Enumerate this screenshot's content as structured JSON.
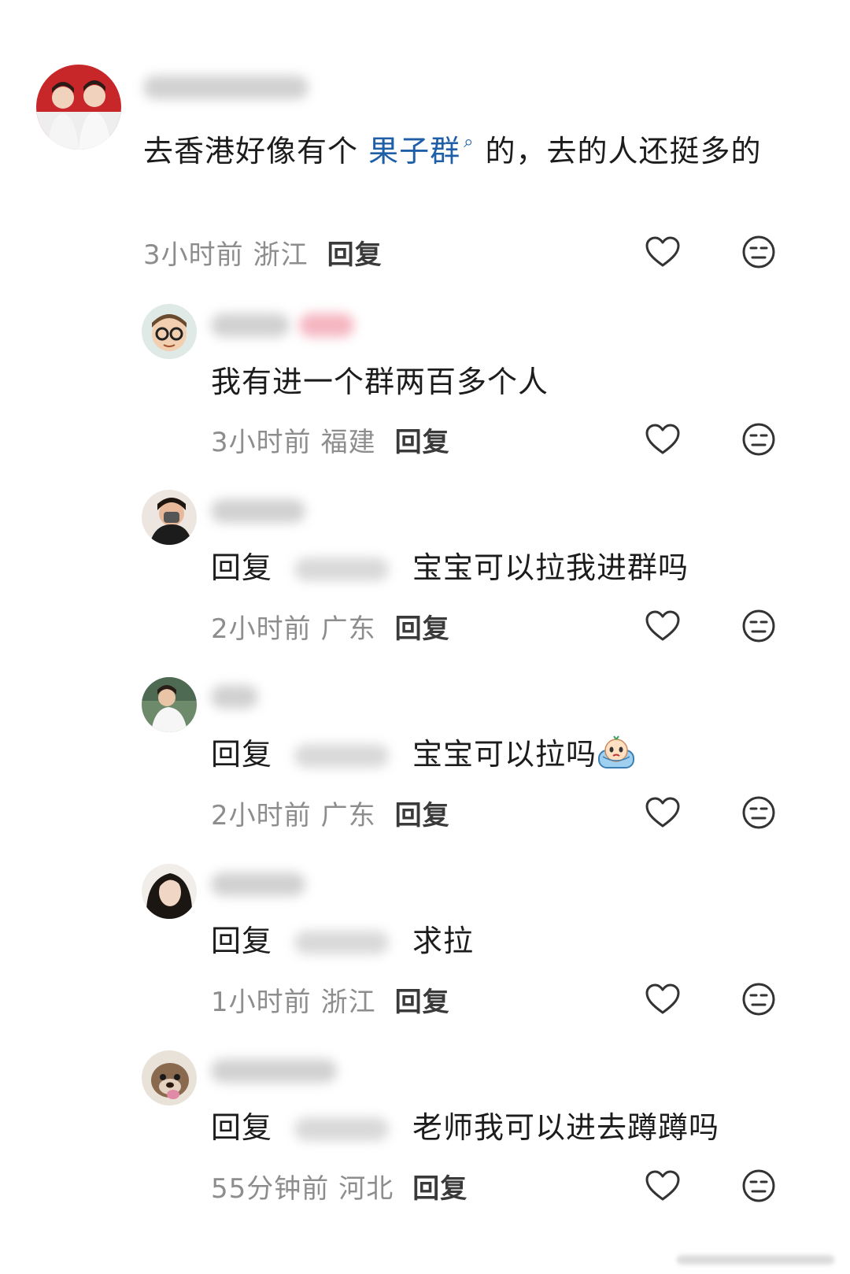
{
  "comments": [
    {
      "text_before": "去香港好像有个 ",
      "link": "果子群",
      "text_after": "的，去的人还挺多的",
      "time": "3小时前",
      "location": "浙江",
      "reply_label": "回复",
      "like_icon": "heart-outline-icon",
      "dislike_icon": "meh-face-icon"
    },
    {
      "text": "我有进一个群两百多个人",
      "time": "3小时前",
      "location": "福建",
      "reply_label": "回复"
    },
    {
      "prefix": "回复",
      "text": "宝宝可以拉我进群吗",
      "time": "2小时前",
      "location": "广东",
      "reply_label": "回复"
    },
    {
      "prefix": "回复",
      "text": "宝宝可以拉吗",
      "emoji": "crying-emoji",
      "time": "2小时前",
      "location": "广东",
      "reply_label": "回复"
    },
    {
      "prefix": "回复",
      "text": "求拉",
      "time": "1小时前",
      "location": "浙江",
      "reply_label": "回复"
    },
    {
      "prefix": "回复",
      "text": "老师我可以进去蹲蹲吗",
      "time": "55分钟前",
      "location": "河北",
      "reply_label": "回复"
    }
  ],
  "colors": {
    "link": "#1f5fa8",
    "meta": "#8d8d8d",
    "text": "#1c1c1c",
    "icon": "#333333"
  }
}
